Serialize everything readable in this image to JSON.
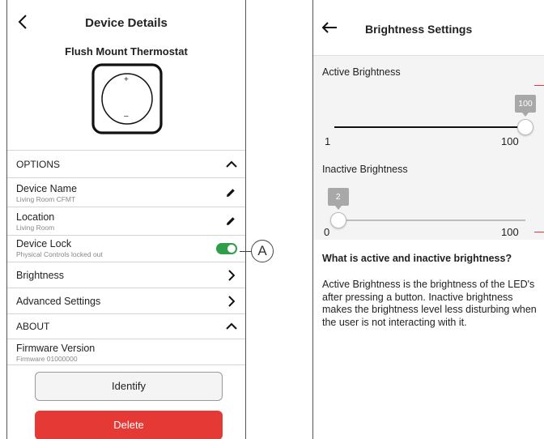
{
  "left": {
    "header_title": "Device Details",
    "device_name_title": "Flush Mount Thermostat",
    "dial_plus": "+",
    "dial_minus": "–",
    "options_header": "OPTIONS",
    "device_name": {
      "label": "Device Name",
      "value": "Living Room CFMT"
    },
    "location": {
      "label": "Location",
      "value": "Living Room"
    },
    "device_lock": {
      "label": "Device Lock",
      "value": "Physical Controls locked out",
      "enabled": true
    },
    "brightness_label": "Brightness",
    "advanced_settings_label": "Advanced Settings",
    "about_header": "ABOUT",
    "firmware": {
      "label": "Firmware Version",
      "value": "Firmware 01000000"
    },
    "identify_label": "Identify",
    "delete_label": "Delete"
  },
  "callout_label": "A",
  "right": {
    "header_title": "Brightness Settings",
    "active": {
      "label": "Active Brightness",
      "value": "100",
      "min": "1",
      "max": "100",
      "level": 1.0
    },
    "inactive": {
      "label": "Inactive Brightness",
      "value": "2",
      "min": "0",
      "max": "100",
      "level": 0.02
    },
    "info_title": "What is active and inactive brightness?",
    "info_text": "Active Brightness is the brightness of the LED's after pressing a button. Inactive brightness makes the brightness level less disturbing when the user is not interacting with it."
  },
  "colors": {
    "toggle_on": "#2e9e48",
    "delete": "#e53935",
    "track_active": "#111111",
    "track_inactive": "#bdbdbd"
  }
}
